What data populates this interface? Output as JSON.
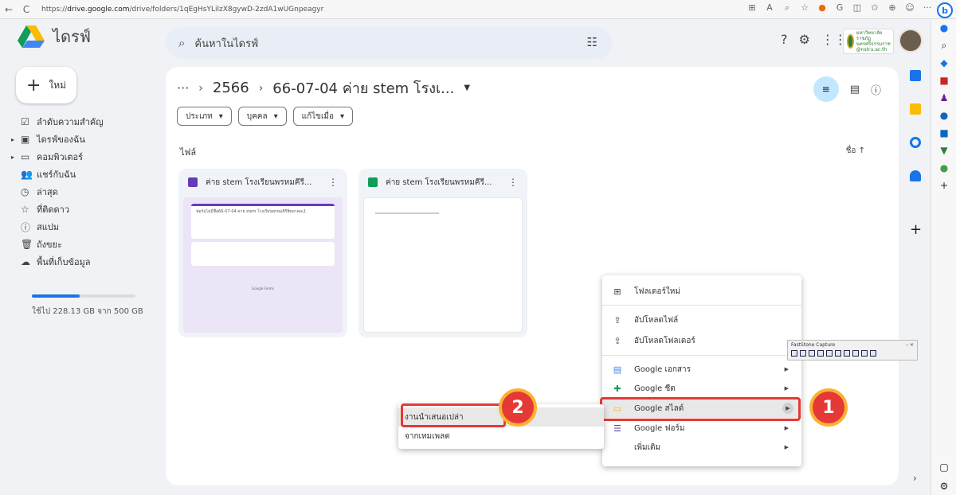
{
  "browser": {
    "back": "←",
    "reload": "C",
    "url_prefix": "https://",
    "url_host": "drive.google.com",
    "url_path": "/drive/folders/1qEgHsYLilzX8gywD-2zdA1wUGnpeagyr"
  },
  "header": {
    "title": "ไดรฟ์",
    "search_placeholder": "ค้นหาในไดรฟ์",
    "account_text": "มหาวิทยาลัยราชภัฏ นครศรีธรรมราช @nstru.ac.th"
  },
  "sidebar": {
    "new_label": "ใหม่",
    "items": [
      {
        "label": "ลำดับความสำคัญ",
        "icon": "☑"
      },
      {
        "label": "ไดรฟ์ของฉัน",
        "icon": "▣"
      },
      {
        "label": "คอมพิวเตอร์",
        "icon": "▭"
      },
      {
        "label": "แชร์กับฉัน",
        "icon": "👥"
      },
      {
        "label": "ล่าสุด",
        "icon": "◷"
      },
      {
        "label": "ที่ติดดาว",
        "icon": "☆"
      },
      {
        "label": "สแปม",
        "icon": "ⓘ"
      },
      {
        "label": "ถังขยะ",
        "icon": "🗑"
      },
      {
        "label": "พื้นที่เก็บข้อมูล",
        "icon": "☁"
      }
    ],
    "storage_text": "ใช้ไป 228.13 GB จาก 500 GB",
    "storage_fraction": 0.46
  },
  "main": {
    "breadcrumb_more": "···",
    "breadcrumb_parent": "2566",
    "breadcrumb_current": "66-07-04 ค่าย stem โรงเ...",
    "chips": [
      "ประเภท",
      "บุคคล",
      "แก้ไขเมื่อ"
    ],
    "files_label": "ไฟล์",
    "sort_label": "ชื่อ",
    "cards": [
      {
        "title": "ค่าย stem โรงเรียนพรหมคีรี...",
        "type": "form",
        "preview_title": "ฟอร์มไม่มีชื่อ66-07-04 ค่าย stem โรงเรียนพรหมคีรีพิทยาคมเ1",
        "preview_footer": "Google Forms"
      },
      {
        "title": "ค่าย stem โรงเรียนพรหมคีรี...",
        "type": "sheet"
      }
    ]
  },
  "menu": {
    "items": [
      {
        "label": "โฟลเดอร์ใหม่",
        "icon": "⊞"
      },
      {
        "label": "อัปโหลดไฟล์",
        "icon": "⇪"
      },
      {
        "label": "อัปโหลดโฟลเดอร์",
        "icon": "⇪"
      },
      {
        "label": "Google เอกสาร",
        "icon": "▤"
      },
      {
        "label": "Google ชีต",
        "icon": "✚"
      },
      {
        "label": "Google สไลด์",
        "icon": "▭"
      },
      {
        "label": "Google ฟอร์ม",
        "icon": "☰"
      },
      {
        "label": "เพิ่มเติม",
        "icon": ""
      }
    ]
  },
  "submenu": {
    "items": [
      "งานนำเสนอเปล่า",
      "จากเทมเพลต"
    ]
  },
  "badges": {
    "one": "1",
    "two": "2"
  },
  "faststone": {
    "title": "FastStone Capture",
    "controls": "– ×"
  },
  "colors": {
    "accent": "#1a73e8",
    "highlight": "#e53935",
    "badge_ring": "#f9b233",
    "docs": "#4285f4",
    "sheets": "#0f9d58",
    "slides": "#f4b400",
    "forms": "#673ab7"
  }
}
